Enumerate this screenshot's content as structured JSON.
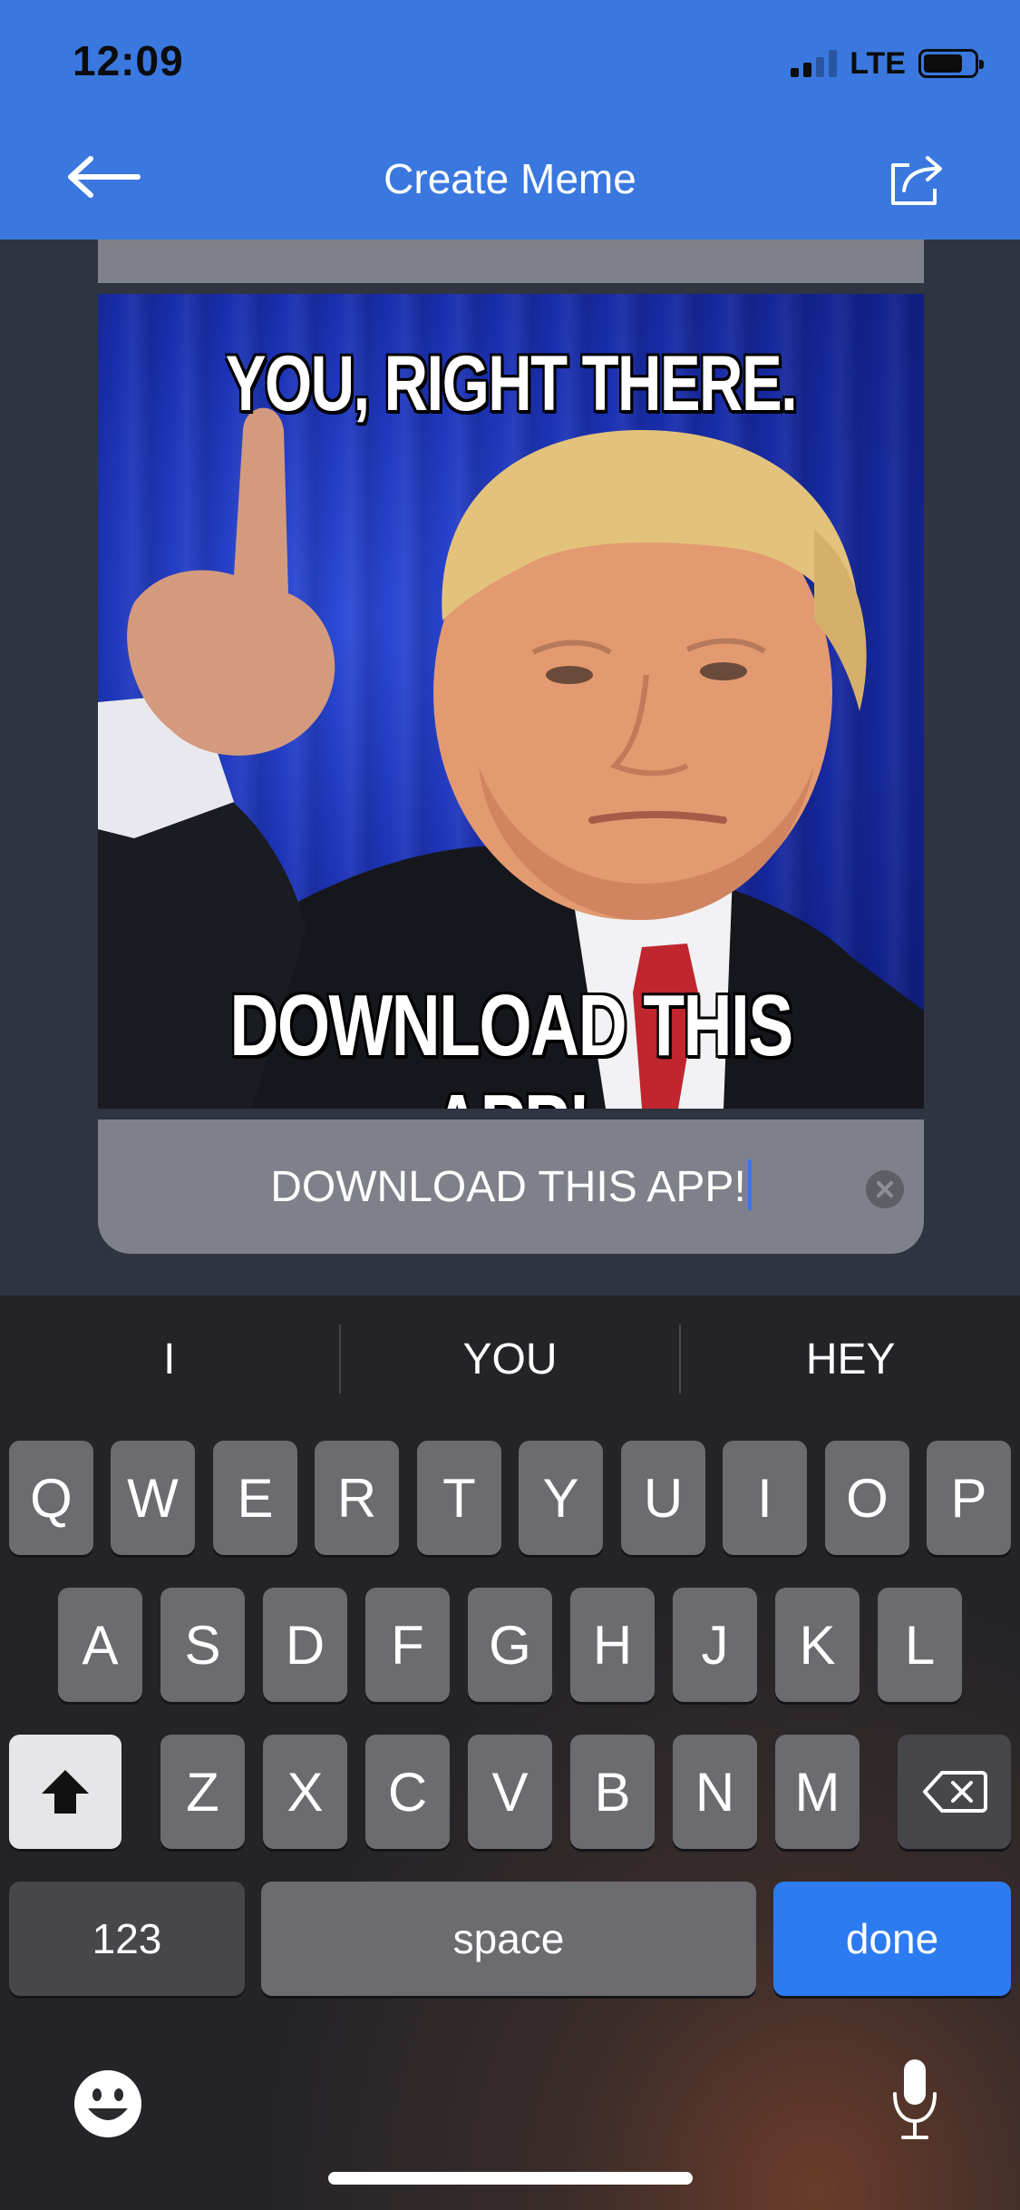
{
  "status_bar": {
    "time": "12:09",
    "network": "LTE"
  },
  "nav": {
    "title": "Create Meme",
    "back_icon": "arrow-left-icon",
    "share_icon": "share-icon"
  },
  "meme": {
    "top_text": "YOU, RIGHT THERE.",
    "bottom_text": "DOWNLOAD THIS APP!"
  },
  "text_field": {
    "value": "DOWNLOAD THIS APP!",
    "clear_icon": "clear-icon"
  },
  "keyboard": {
    "suggestions": [
      "I",
      "YOU",
      "HEY"
    ],
    "row1": [
      "Q",
      "W",
      "E",
      "R",
      "T",
      "Y",
      "U",
      "I",
      "O",
      "P"
    ],
    "row2": [
      "A",
      "S",
      "D",
      "F",
      "G",
      "H",
      "J",
      "K",
      "L"
    ],
    "row3": [
      "Z",
      "X",
      "C",
      "V",
      "B",
      "N",
      "M"
    ],
    "numbers_label": "123",
    "space_label": "space",
    "done_label": "done"
  },
  "colors": {
    "header": "#3a78df",
    "done_key": "#2c7bf0",
    "background": "#2e3440"
  }
}
